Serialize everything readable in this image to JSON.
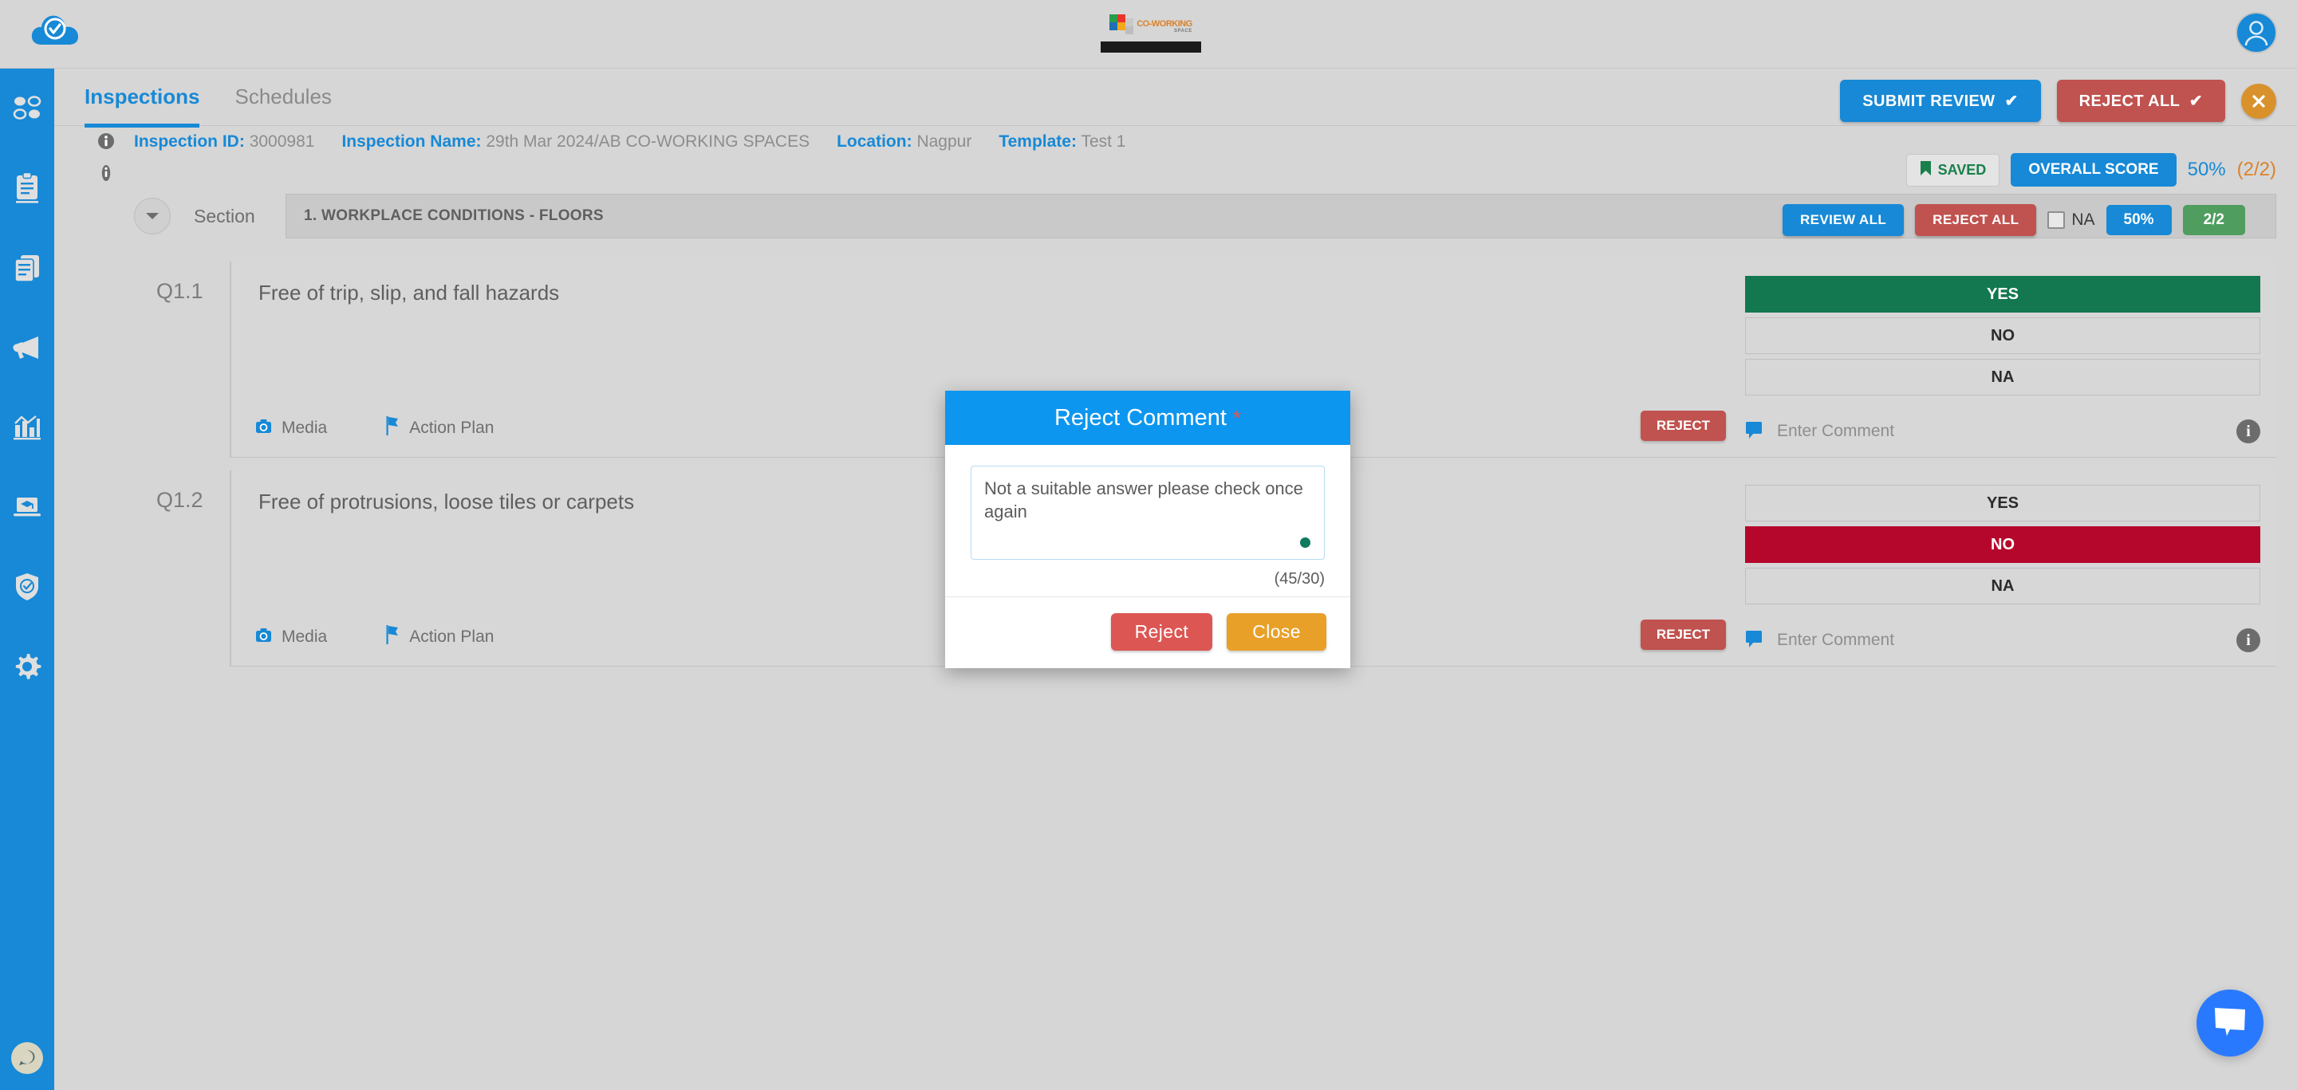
{
  "topbar": {
    "brand_icon": "cloud-check-icon",
    "center_logo": {
      "primary": "CO-WORKING",
      "secondary": "SPACE"
    },
    "avatar_icon": "user-avatar-icon"
  },
  "sidebar": {
    "items": [
      {
        "icon": "dashboard-grid-icon",
        "name": "dashboard"
      },
      {
        "icon": "clipboard-icon",
        "name": "inspections"
      },
      {
        "icon": "documents-icon",
        "name": "documents"
      },
      {
        "icon": "megaphone-icon",
        "name": "announcements"
      },
      {
        "icon": "bar-chart-icon",
        "name": "analytics"
      },
      {
        "icon": "training-laptop-icon",
        "name": "training"
      },
      {
        "icon": "shield-check-icon",
        "name": "compliance"
      },
      {
        "icon": "gear-icon",
        "name": "settings"
      }
    ],
    "chat_badge_icon": "chat-bubble-icon"
  },
  "tabs": [
    {
      "label": "Inspections",
      "active": true
    },
    {
      "label": "Schedules",
      "active": false
    }
  ],
  "top_actions": {
    "submit_review": "SUBMIT REVIEW",
    "reject_all": "REJECT ALL",
    "close_icon": "close-x-icon"
  },
  "info": {
    "inspection_id_label": "Inspection ID:",
    "inspection_id_value": "3000981",
    "inspection_name_label": "Inspection Name:",
    "inspection_name_value": "29th Mar 2024/AB CO-WORKING SPACES",
    "location_label": "Location:",
    "location_value": "Nagpur",
    "template_label": "Template:",
    "template_value": "Test 1"
  },
  "status": {
    "saved_label": "SAVED",
    "saved_icon": "bookmark-flag-icon",
    "overall_score_label": "OVERALL SCORE",
    "score_percent": "50%",
    "score_fraction": "(2/2)"
  },
  "section": {
    "chevron_icon": "chevron-down-icon",
    "label": "Section",
    "title": "1. WORKPLACE CONDITIONS - FLOORS",
    "review_all": "REVIEW ALL",
    "reject_all": "REJECT ALL",
    "na_label": "NA",
    "na_checked": false,
    "percent": "50%",
    "fraction": "2/2"
  },
  "questions": [
    {
      "number": "Q1.1",
      "text": "Free of trip, slip, and fall hazards",
      "media_label": "Media",
      "media_icon": "camera-icon",
      "action_plan_label": "Action Plan",
      "action_plan_icon": "flag-icon",
      "reject_label": "REJECT",
      "answers": [
        "YES",
        "NO",
        "NA"
      ],
      "selected": "YES",
      "comment_placeholder": "Enter Comment",
      "comment_icon": "comment-bubble-icon",
      "info_icon": "info-icon"
    },
    {
      "number": "Q1.2",
      "text": "Free of protrusions, loose tiles or carpets",
      "media_label": "Media",
      "media_icon": "camera-icon",
      "action_plan_label": "Action Plan",
      "action_plan_icon": "flag-icon",
      "reject_label": "REJECT",
      "answers": [
        "YES",
        "NO",
        "NA"
      ],
      "selected": "NO",
      "comment_placeholder": "Enter Comment",
      "comment_icon": "comment-bubble-icon",
      "info_icon": "info-icon"
    }
  ],
  "modal": {
    "title": "Reject Comment",
    "required_marker": "*",
    "textarea_value": "Not a suitable answer please check once again",
    "counter": "(45/30)",
    "reject_button": "Reject",
    "close_button": "Close"
  },
  "fab": {
    "icon": "chat-bubble-icon"
  },
  "colors": {
    "brand_blue": "#1789d6",
    "modal_header_blue": "#0d96ef",
    "reject_red": "#c0524f",
    "selected_yes_green": "#13784f",
    "selected_no_red": "#b5072c",
    "orange": "#d9822b",
    "saved_green": "#1a7f4b",
    "frac_green": "#4f9e5f"
  }
}
